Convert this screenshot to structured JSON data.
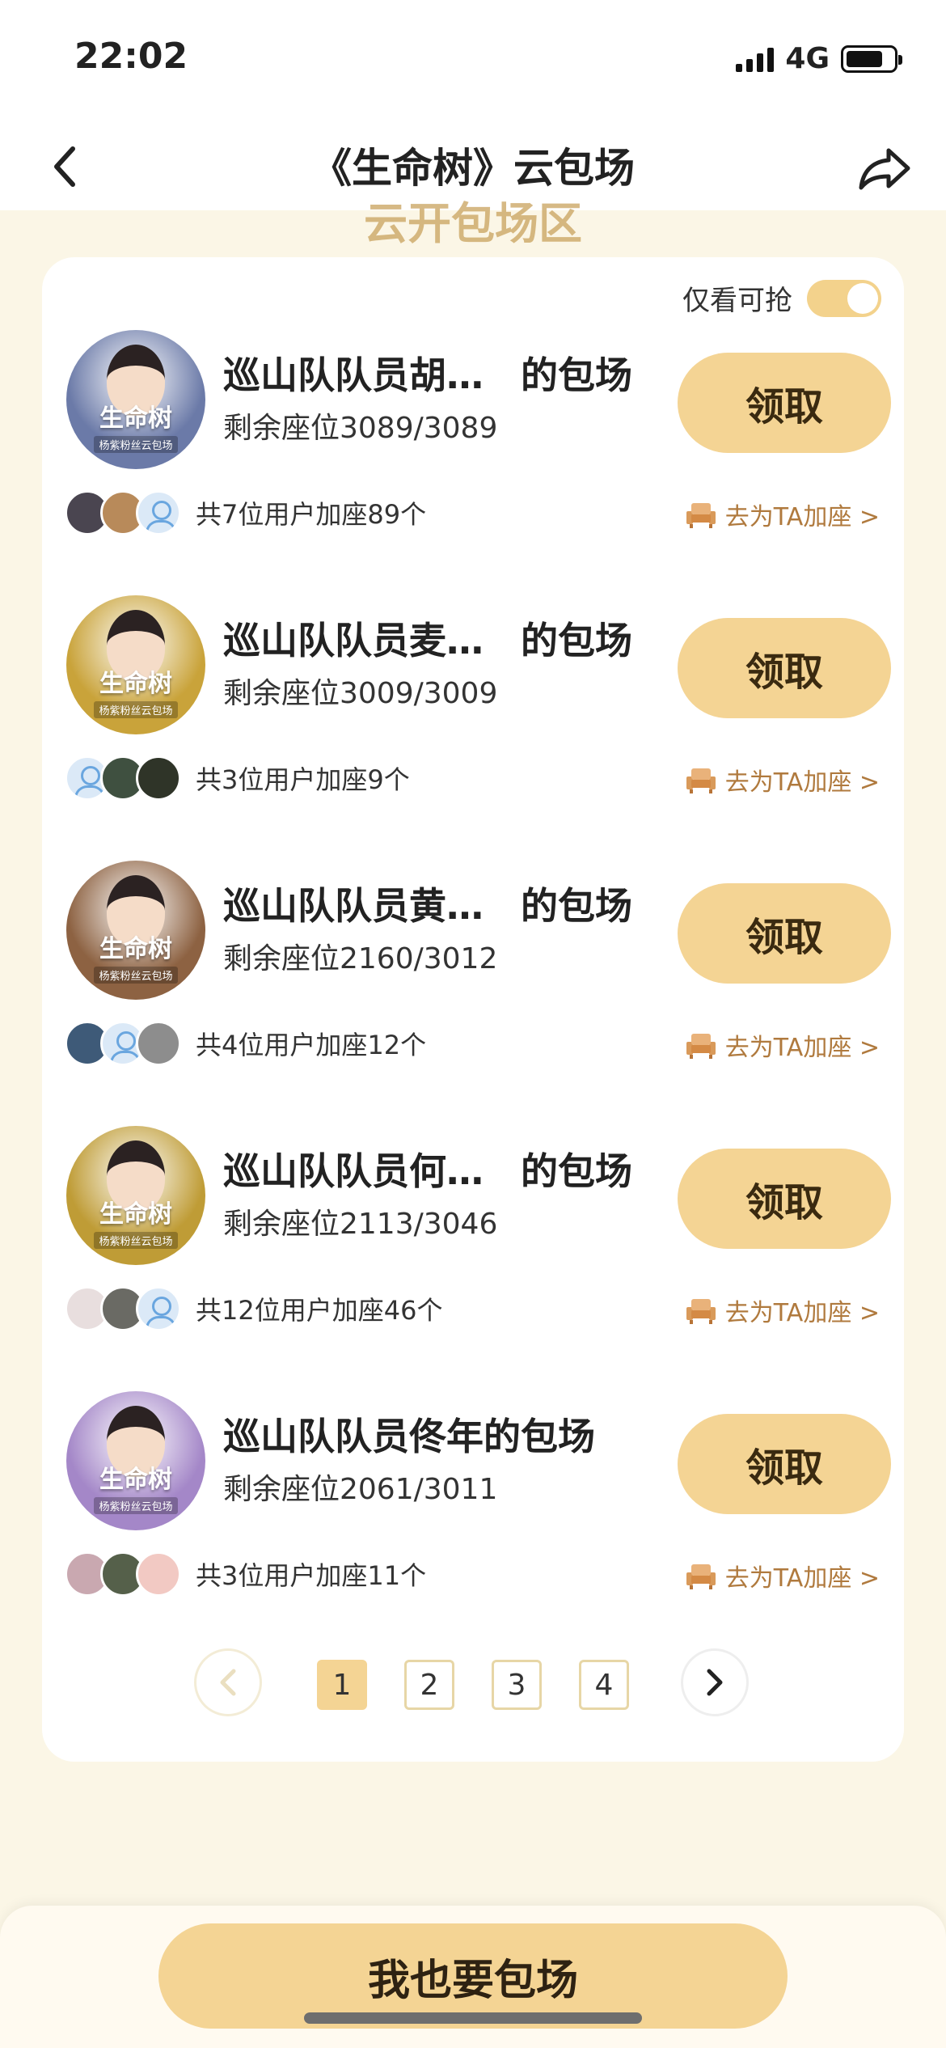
{
  "status": {
    "time": "22:02",
    "network": "4G"
  },
  "nav": {
    "title": "《生命树》云包场",
    "back_icon": "chevron-left-icon",
    "share_icon": "share-arrow-icon"
  },
  "section_heading_partial": "云开包场区",
  "filter": {
    "label": "仅看可抢",
    "enabled": true
  },
  "poster": {
    "title": "生命树",
    "subtitle": "杨紫粉丝云包场"
  },
  "items": [
    {
      "title": "巡山队队员胡…　的包场",
      "seats": "剩余座位3089/3089",
      "claim": "领取",
      "members": "共7位用户加座89个",
      "join": "去为TA加座 >",
      "avatar_bg": "#6b7aa8"
    },
    {
      "title": "巡山队队员麦…　的包场",
      "seats": "剩余座位3009/3009",
      "claim": "领取",
      "members": "共3位用户加座9个",
      "join": "去为TA加座 >",
      "avatar_bg": "#c9a33a"
    },
    {
      "title": "巡山队队员黄…　的包场",
      "seats": "剩余座位2160/3012",
      "claim": "领取",
      "members": "共4位用户加座12个",
      "join": "去为TA加座 >",
      "avatar_bg": "#8d6242"
    },
    {
      "title": "巡山队队员何…　的包场",
      "seats": "剩余座位2113/3046",
      "claim": "领取",
      "members": "共12位用户加座46个",
      "join": "去为TA加座 >",
      "avatar_bg": "#bf9c36"
    },
    {
      "title": "巡山队队员佟年的包场",
      "seats": "剩余座位2061/3011",
      "claim": "领取",
      "members": "共3位用户加座11个",
      "join": "去为TA加座 >",
      "avatar_bg": "#a487c8"
    }
  ],
  "pagination": {
    "pages": [
      "1",
      "2",
      "3",
      "4"
    ],
    "current": "1"
  },
  "bottom": {
    "button": "我也要包场"
  },
  "colors": {
    "accent": "#f4d494",
    "link": "#b07a3e",
    "background": "#fbf6e6"
  }
}
